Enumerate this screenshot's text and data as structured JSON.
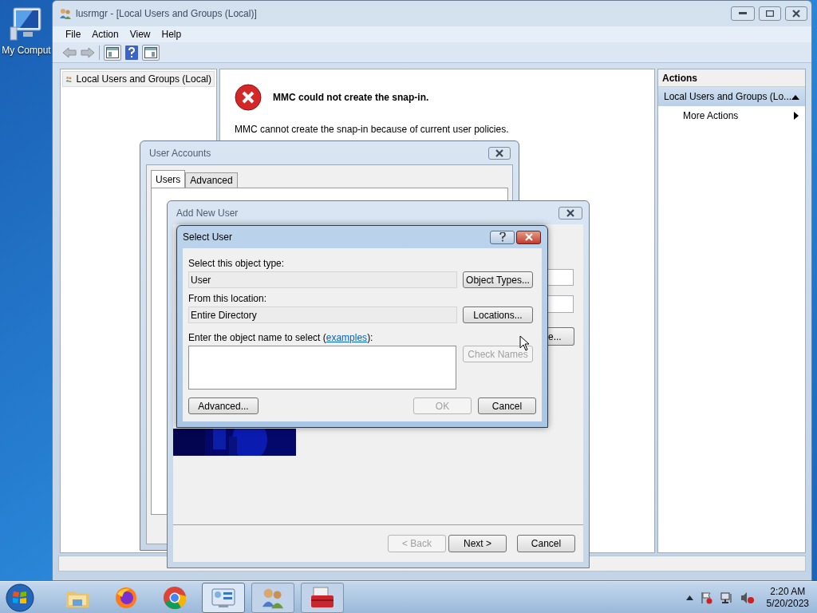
{
  "desktop": {
    "icons": [
      {
        "label": "My Comput"
      }
    ]
  },
  "mmc_window": {
    "title": "lusrmgr - [Local Users and Groups (Local)]",
    "menu": [
      "File",
      "Action",
      "View",
      "Help"
    ],
    "tree": [
      {
        "label": "Local Users and Groups (Local)",
        "selected": true
      }
    ],
    "error": {
      "heading": "MMC could not create the snap-in.",
      "message": "MMC cannot create the snap-in because of current user policies."
    },
    "actions": {
      "header": "Actions",
      "section": "Local Users and Groups (Lo...",
      "expanded": true,
      "items": [
        "More Actions"
      ]
    }
  },
  "user_accounts_dialog": {
    "title": "User Accounts",
    "tabs": [
      {
        "label": "Users",
        "selected": true
      },
      {
        "label": "Advanced",
        "selected": false
      }
    ]
  },
  "add_new_user_dialog": {
    "title": "Add New User",
    "button_fragment": "e...",
    "buttons": [
      {
        "label": "< Back",
        "disabled": true
      },
      {
        "label": "Next >",
        "disabled": false
      },
      {
        "label": "Cancel",
        "disabled": false
      }
    ]
  },
  "select_user_dialog": {
    "title": "Select User",
    "object_type_label": "Select this object type:",
    "object_type": "User",
    "object_types_button": "Object Types...",
    "location_label": "From this location:",
    "location": "Entire Directory",
    "locations_button": "Locations...",
    "name_prompt": "Enter the object name to select (",
    "examples_link": "examples",
    "name_prompt_end": "):",
    "check_names": {
      "label": "Check Names",
      "disabled": true
    },
    "buttons": [
      {
        "label": "Advanced...",
        "disabled": false
      },
      {
        "label": "OK",
        "disabled": true
      },
      {
        "label": "Cancel",
        "disabled": false
      }
    ]
  },
  "taskbar": {
    "items": [
      {
        "kind": "pinned",
        "selected": false
      },
      {
        "kind": "pinned",
        "selected": false
      },
      {
        "kind": "pinned",
        "selected": false
      },
      {
        "kind": "running",
        "selected": true
      },
      {
        "kind": "running",
        "selected": false
      },
      {
        "kind": "running",
        "selected": false
      }
    ],
    "clock": {
      "time": "2:20 AM",
      "date": "5/20/2023"
    }
  }
}
